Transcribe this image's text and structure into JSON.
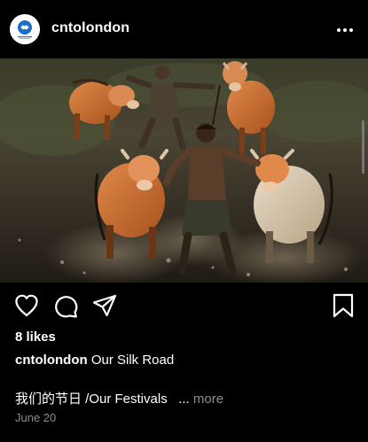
{
  "post": {
    "username": "cntolondon",
    "photo_description": "",
    "likes_text": "8 likes",
    "caption_user": "cntolondon",
    "caption_text": "Our Silk Road",
    "caption_line2": "我们的节日 /Our Festivals",
    "caption_ellipsis": "...",
    "more_label": "more",
    "date": "June 20"
  },
  "icons": {
    "menu": "more-horizontal-icon",
    "like": "heart-icon",
    "comment": "comment-icon",
    "share": "send-icon",
    "save": "bookmark-icon"
  },
  "colors": {
    "background": "#000000",
    "text": "#ffffff",
    "secondary_text": "#8e8e8e",
    "avatar_accent": "#1a6fc9"
  }
}
